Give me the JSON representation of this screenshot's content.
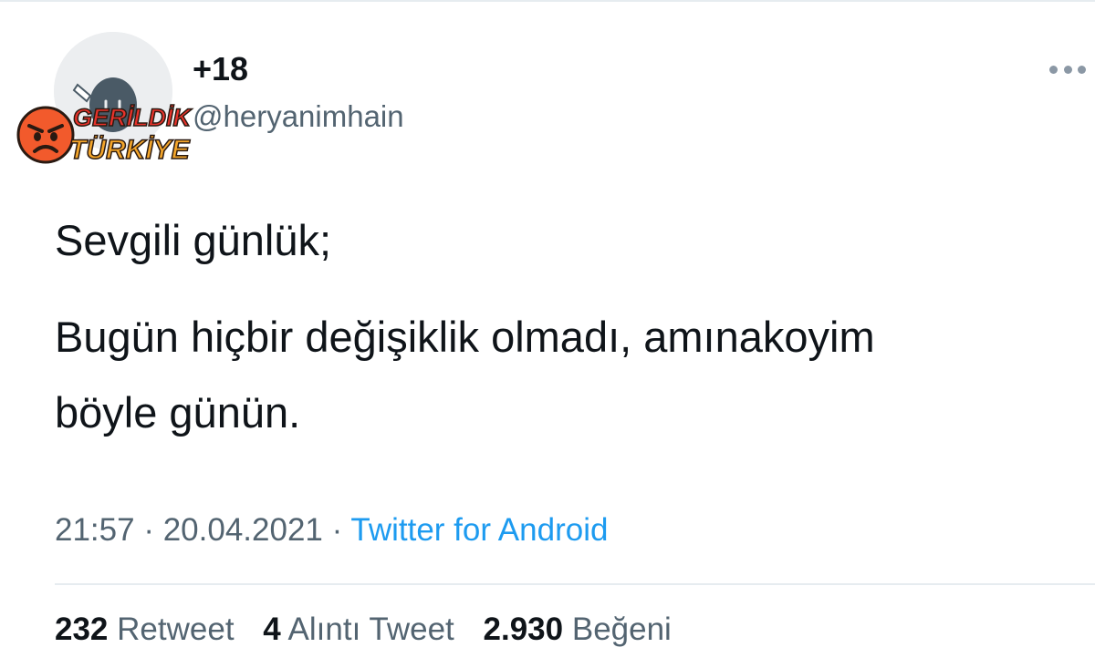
{
  "user": {
    "display_name": "+18",
    "handle": "@heryanimhain"
  },
  "watermark": {
    "line1": "GERİLDİK",
    "line2": "TÜRKİYE"
  },
  "tweet": {
    "line1": "Sevgili günlük;",
    "line2": "Bugün hiçbir değişiklik olmadı, amınakoyim",
    "line3": "böyle günün."
  },
  "meta": {
    "time": "21:57",
    "date": "20.04.2021",
    "sep": "·",
    "source": "Twitter for Android"
  },
  "stats": {
    "retweets": "232",
    "retweets_label": "Retweet",
    "quotes": "4",
    "quotes_label": "Alıntı Tweet",
    "likes": "2.930",
    "likes_label": "Beğeni"
  },
  "icons": {
    "more": "more-horizontal-icon",
    "watermark_face": "angry-face-icon"
  },
  "colors": {
    "text": "#0f1419",
    "secondary": "#536471",
    "link": "#1d9bf0",
    "divider": "#e6ecf0"
  }
}
